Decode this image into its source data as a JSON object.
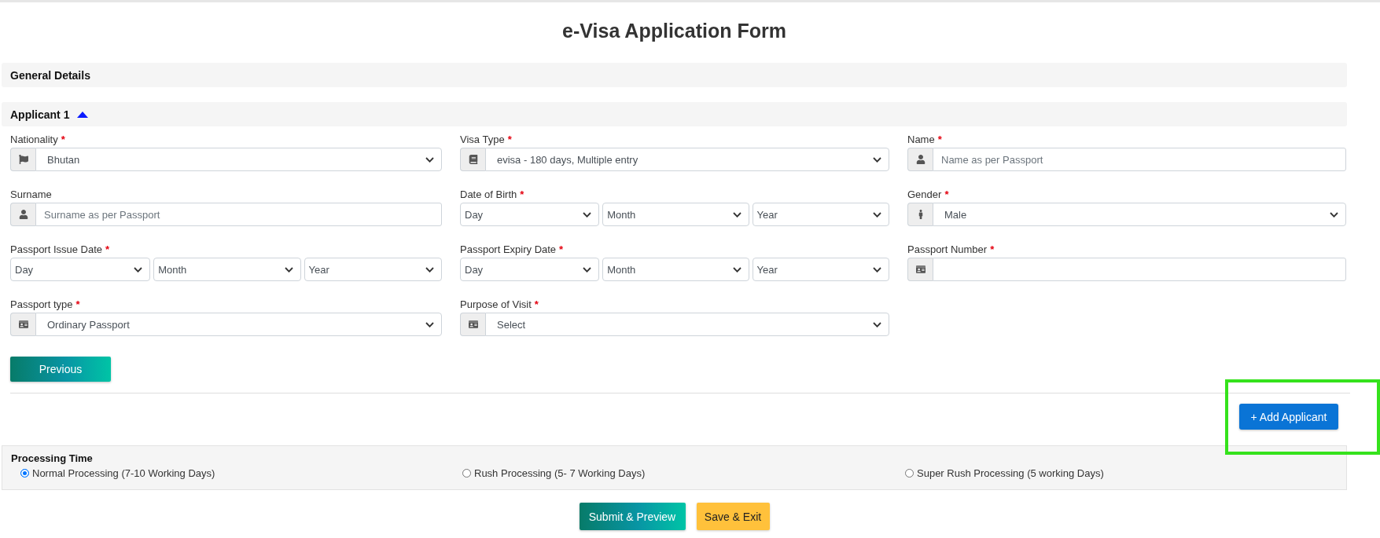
{
  "page": {
    "title": "e-Visa Application Form"
  },
  "general_details": {
    "title": "General Details"
  },
  "applicant": {
    "title": "Applicant 1",
    "expanded": true,
    "fields": [
      {
        "kind": "select",
        "label": "Nationality",
        "required_mark": "*",
        "value": "Bhutan"
      },
      {
        "kind": "select",
        "label": "Visa Type",
        "required_mark": "*",
        "value": "evisa - 180 days, Multiple entry"
      },
      {
        "kind": "text",
        "label": "Name",
        "required_mark": "*",
        "placeholder": "Name as per Passport"
      },
      {
        "kind": "text",
        "label": "Surname",
        "placeholder": "Surname as per Passport"
      },
      {
        "kind": "date",
        "label": "Date of Birth",
        "required_mark": "*",
        "parts": [
          "Day",
          "Month",
          "Year"
        ]
      },
      {
        "kind": "select",
        "label": "Gender",
        "required_mark": "*",
        "value": "Male"
      },
      {
        "kind": "date",
        "label": "Passport Issue Date",
        "required_mark": "*",
        "parts": [
          "Day",
          "Month",
          "Year"
        ]
      },
      {
        "kind": "date",
        "label": "Passport Expiry Date",
        "required_mark": "*",
        "parts": [
          "Day",
          "Month",
          "Year"
        ]
      },
      {
        "kind": "text",
        "label": "Passport Number",
        "required_mark": "*"
      },
      {
        "kind": "select",
        "label": "Passport type",
        "required_mark": "*",
        "value": "Ordinary Passport"
      },
      {
        "kind": "select",
        "label": "Purpose of Visit",
        "required_mark": "*",
        "value": "Select"
      }
    ]
  },
  "previous_button": "Previous",
  "add_applicant": {
    "label": "+ Add Applicant",
    "highlighted": true
  },
  "processing_time": {
    "title": "Processing Time",
    "options": [
      {
        "label": "Normal Processing (7-10 Working Days)",
        "selected": true
      },
      {
        "label": "Rush Processing (5- 7 Working Days)",
        "selected": false
      },
      {
        "label": "Super Rush Processing (5 working Days)",
        "selected": false
      }
    ]
  },
  "actions": [
    {
      "kind": "primary",
      "label": "Submit & Preview"
    },
    {
      "kind": "warning",
      "label": "Save & Exit"
    }
  ]
}
